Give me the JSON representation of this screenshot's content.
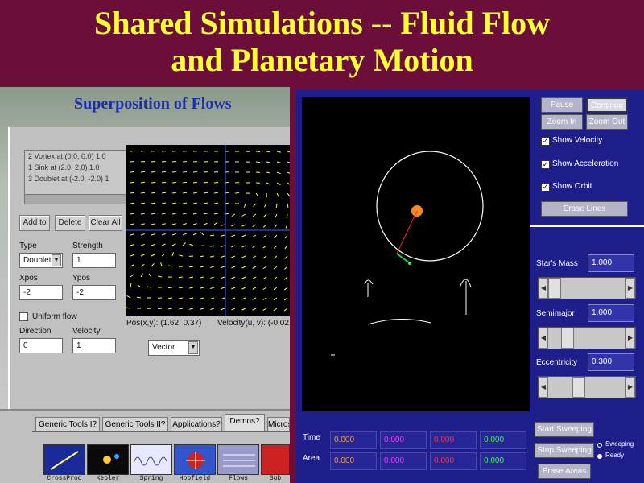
{
  "slide": {
    "title_line1": "Shared Simulations -- Fluid Flow",
    "title_line2": "and Planetary Motion"
  },
  "flows_applet": {
    "title": "Superposition of Flows",
    "list_items": [
      "2 Vortex at (0.0, 0.0) 1.0",
      "1 Sink at (2.0, 2.0) 1.0",
      "3 Doublet at (-2.0, -2.0) 1"
    ],
    "buttons": {
      "add": "Add to",
      "delete": "Delete",
      "clear": "Clear All"
    },
    "type_label": "Type",
    "type_value": "Doublet",
    "strength_label": "Strength",
    "strength_value": "1",
    "xpos_label": "Xpos",
    "xpos_value": "-2",
    "ypos_label": "Ypos",
    "ypos_value": "-2",
    "uniform_flow_label": "Uniform flow",
    "direction_label": "Direction",
    "direction_value": "0",
    "velocity_label": "Velocity",
    "velocity_value": "1",
    "pos_readout": "Pos(x,y):  (1.62, 0.37)",
    "vel_readout": "Velocity(u, v):  (-0.02,",
    "display_select": "Vector"
  },
  "bottom_left": {
    "tabs": [
      "Generic Tools I?",
      "Generic Tools II?",
      "Applications?",
      "Demos?",
      "Micros"
    ],
    "active_tab": "Demos?",
    "tools": [
      {
        "label": "CrossProd",
        "color": "#1a2a9a"
      },
      {
        "label": "Kepler",
        "color": "#0a0a0a"
      },
      {
        "label": "Spring",
        "color": "#e8e8ff"
      },
      {
        "label": "Hopfield",
        "color": "#3355cc"
      },
      {
        "label": "Flows",
        "color": "#9999cc"
      },
      {
        "label": "Sub",
        "color": "#cc2222"
      }
    ]
  },
  "kepler_applet": {
    "buttons": {
      "pause": "Pause",
      "continue": "Continue",
      "zoom_in": "Zoom In",
      "zoom_out": "Zoom Out",
      "erase_lines": "Erase Lines"
    },
    "checkboxes": [
      {
        "label": "Show Velocity",
        "checked": true
      },
      {
        "label": "Show Acceleration",
        "checked": true
      },
      {
        "label": "Show Orbit",
        "checked": true
      }
    ],
    "star_mass_label": "Star's Mass",
    "star_mass_value": "1.000",
    "semimajor_label": "Semimajor",
    "semimajor_value": "1.000",
    "eccentricity_label": "Eccentricity",
    "eccentricity_value": "0.300",
    "time_label": "Time",
    "area_label": "Area",
    "time_values": [
      "0.000",
      "0.000",
      "0.000",
      "0.000"
    ],
    "area_values": [
      "0.000",
      "0.000",
      "0.000",
      "0.000"
    ],
    "cell_colors": [
      "#ff9933",
      "#ff33ff",
      "#ff3333",
      "#33ff33"
    ],
    "start_sweeping": "Start Sweeping",
    "stop_sweeping": "Stop Sweeping",
    "erase_areas": "Erase Areas",
    "status": [
      {
        "label": "Sweeping",
        "active": false
      },
      {
        "label": "Ready",
        "active": true
      }
    ]
  }
}
